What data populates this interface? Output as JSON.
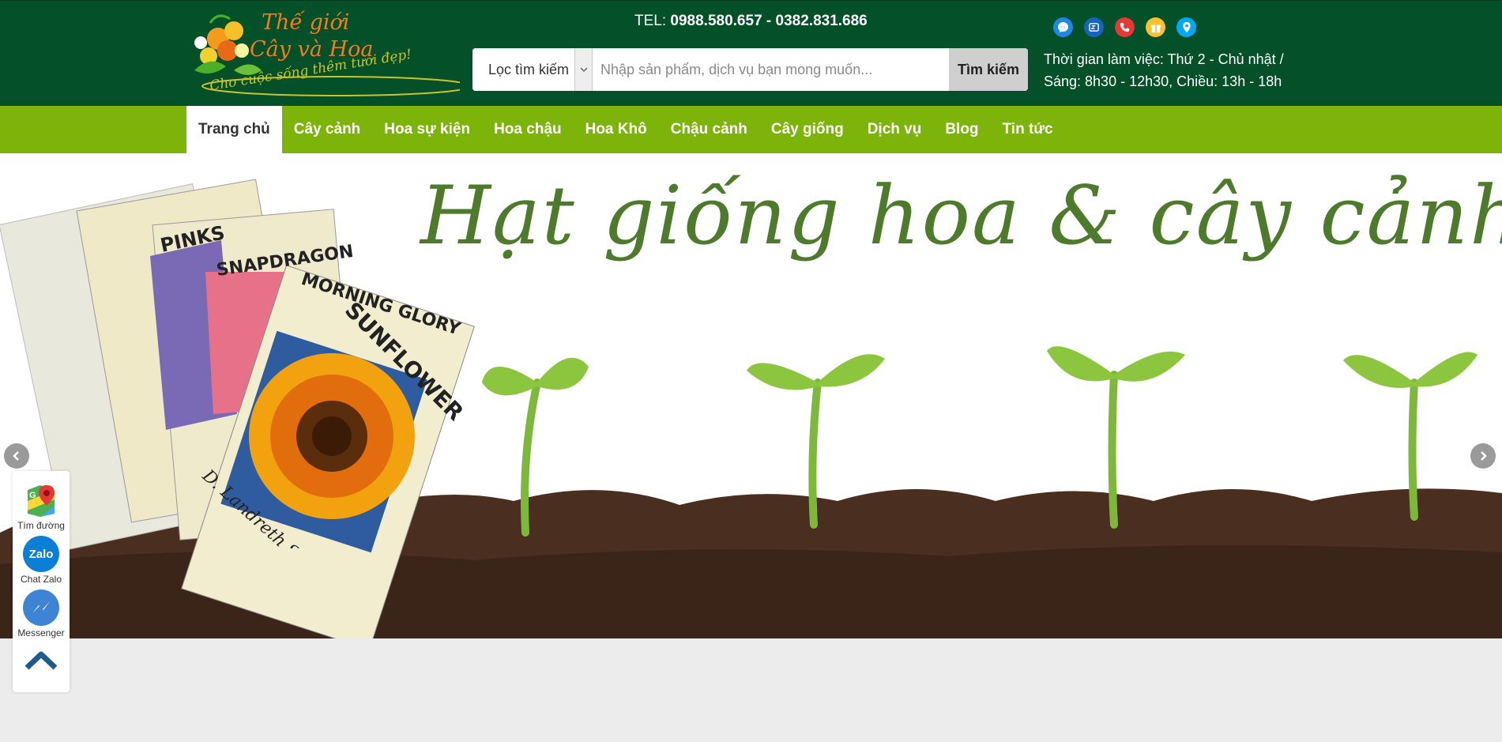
{
  "header": {
    "logo": {
      "line1": "Thế giới",
      "line2": "Cây và Hoa",
      "slogan": "Cho cuộc sống thêm tươi đẹp!"
    },
    "tel_label": "TEL:",
    "tel_numbers": "0988.580.657 - 0382.831.686",
    "search": {
      "filter_label": "Lọc tìm kiếm",
      "placeholder": "Nhập sản phẩm, dịch vụ bạn mong muốn...",
      "button_label": "Tìm kiếm"
    },
    "social_icons": [
      "messenger-icon",
      "zalo-icon",
      "phone-icon",
      "gift-icon",
      "location-icon"
    ],
    "hours_line1": "Thời gian làm việc: Thứ 2 - Chủ nhật /",
    "hours_line2": "Sáng: 8h30 - 12h30, Chiều: 13h - 18h"
  },
  "nav": {
    "items": [
      {
        "label": "Trang chủ",
        "active": true
      },
      {
        "label": "Cây cảnh"
      },
      {
        "label": "Hoa sự kiện"
      },
      {
        "label": "Hoa chậu"
      },
      {
        "label": "Hoa Khô"
      },
      {
        "label": "Chậu cảnh"
      },
      {
        "label": "Cây giống"
      },
      {
        "label": "Dịch vụ"
      },
      {
        "label": "Blog"
      },
      {
        "label": "Tin tức"
      }
    ]
  },
  "banner": {
    "title": "Hạt giống hoa & cây cảnh",
    "packets": [
      "PINKS",
      "SNAPDRAGON",
      "MORNING GLORY",
      "SUNFLOWER"
    ],
    "brand": "D. Landreth Seed Co."
  },
  "floating": {
    "items": [
      {
        "label": "Tìm đường",
        "icon": "google-maps-icon"
      },
      {
        "label": "Chat Zalo",
        "icon": "zalo-icon",
        "icon_text": "Zalo"
      },
      {
        "label": "Messenger",
        "icon": "messenger-icon"
      }
    ]
  },
  "colors": {
    "header_bg": "#045028",
    "nav_bg": "#7cb40a",
    "accent_text": "#4d7a2b"
  }
}
